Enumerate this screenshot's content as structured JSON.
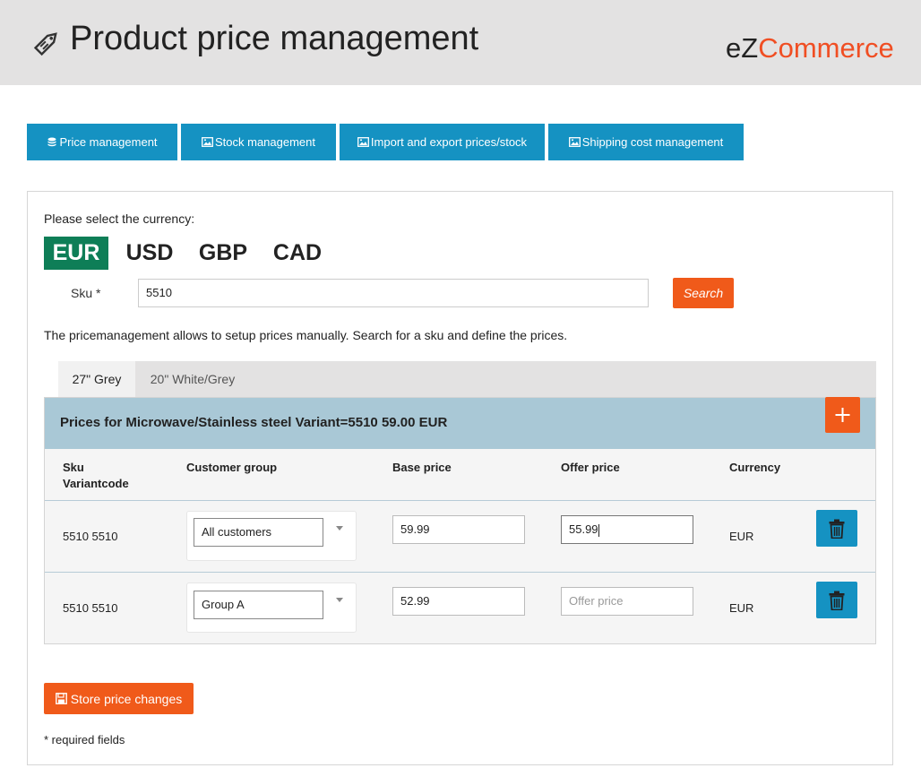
{
  "header": {
    "title": "Product price management",
    "logo_ez": "eZ",
    "logo_commerce": "Commerce",
    "title_icon": "price-tag-icon"
  },
  "nav": [
    {
      "label": "Price management",
      "icon": "database-icon"
    },
    {
      "label": "Stock management",
      "icon": "image-icon"
    },
    {
      "label": "Import and export prices/stock",
      "icon": "image-icon"
    },
    {
      "label": "Shipping cost management",
      "icon": "image-icon"
    }
  ],
  "currency": {
    "prompt": "Please select the currency:",
    "options": [
      "EUR",
      "USD",
      "GBP",
      "CAD"
    ],
    "selected": "EUR"
  },
  "sku": {
    "label": "Sku *",
    "value": "5510",
    "search_label": "Search"
  },
  "info_text": "The pricemanagement allows to setup prices manually. Search for a sku and define the prices.",
  "tabs": [
    {
      "label": "27\" Grey",
      "active": true
    },
    {
      "label": "20\" White/Grey",
      "active": false
    }
  ],
  "prices": {
    "title": "Prices for Microwave/Stainless steel Variant=5510 59.00 EUR",
    "columns": {
      "sku_line1": "Sku",
      "sku_line2": "Variantcode",
      "customer_group": "Customer group",
      "base_price": "Base price",
      "offer_price": "Offer price",
      "currency": "Currency"
    },
    "rows": [
      {
        "sku": "5510 5510",
        "group": "All customers",
        "base": "59.99",
        "offer": "55.99",
        "offer_placeholder": "Offer price",
        "currency": "EUR"
      },
      {
        "sku": "5510 5510",
        "group": "Group A",
        "base": "52.99",
        "offer": "",
        "offer_placeholder": "Offer price",
        "currency": "EUR"
      }
    ]
  },
  "footer": {
    "store_label": "Store price changes",
    "required_note": "* required fields"
  },
  "colors": {
    "nav_blue": "#1592c2",
    "accent_orange": "#f05a1a",
    "active_green": "#0e7e57",
    "header_gray": "#e3e2e2",
    "table_head_blue": "#a9c8d6"
  }
}
